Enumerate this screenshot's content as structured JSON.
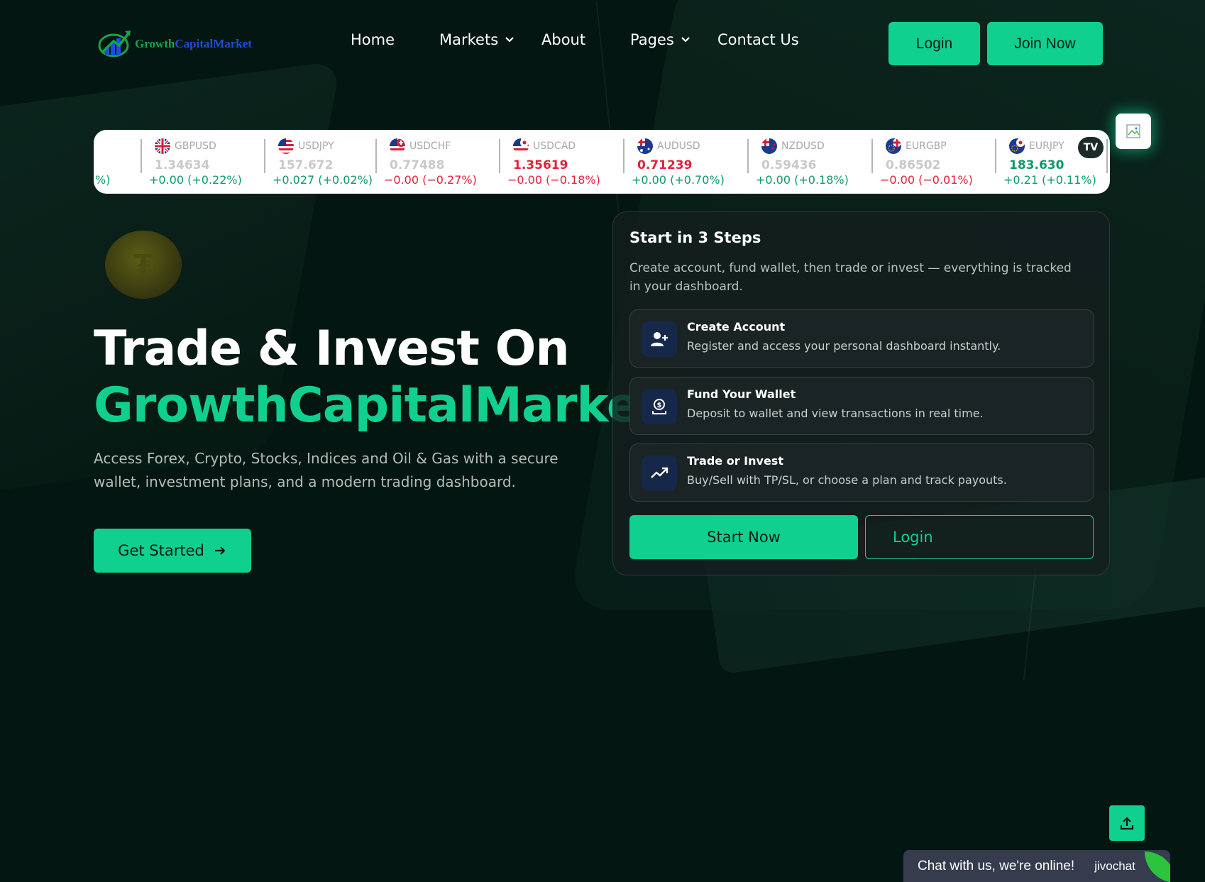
{
  "brand": {
    "part1": "Growth",
    "part2": "CapitalMarket"
  },
  "nav": {
    "home": "Home",
    "markets": "Markets",
    "about": "About",
    "pages": "Pages",
    "contact": "Contact Us"
  },
  "header_buttons": {
    "login": "Login",
    "join": "Join Now"
  },
  "ticker": {
    "partial": "%)",
    "items": [
      {
        "symbol": "GBPUSD",
        "price": "1.34634",
        "change": "+0.00 (+0.22%)"
      },
      {
        "symbol": "USDJPY",
        "price": "157.672",
        "change": "+0.027 (+0.02%)"
      },
      {
        "symbol": "USDCHF",
        "price": "0.77488",
        "change": "−0.00 (−0.27%)"
      },
      {
        "symbol": "USDCAD",
        "price": "1.35619",
        "change": "−0.00 (−0.18%)"
      },
      {
        "symbol": "AUDUSD",
        "price": "0.71239",
        "change": "+0.00 (+0.70%)"
      },
      {
        "symbol": "NZDUSD",
        "price": "0.59436",
        "change": "+0.00 (+0.18%)"
      },
      {
        "symbol": "EURGBP",
        "price": "0.86502",
        "change": "−0.00 (−0.01%)"
      },
      {
        "symbol": "EURJPY",
        "price": "183.630",
        "change": "+0.21 (+0.11%)"
      }
    ],
    "badge": "TV"
  },
  "hero": {
    "title_line1": "Trade & Invest On",
    "title_line2": "GrowthCapitalMarket",
    "subtitle": "Access Forex, Crypto, Stocks, Indices and Oil & Gas with a secure wallet, investment plans, and a modern trading dashboard.",
    "cta": "Get Started"
  },
  "steps_card": {
    "title": "Start in 3 Steps",
    "description": "Create account, fund wallet, then trade or invest — everything is tracked in your dashboard.",
    "steps": [
      {
        "title": "Create Account",
        "desc": "Register and access your personal dashboard instantly.",
        "icon": "user-plus-icon"
      },
      {
        "title": "Fund Your Wallet",
        "desc": "Deposit to wallet and view transactions in real time.",
        "icon": "wallet-deposit-icon"
      },
      {
        "title": "Trade or Invest",
        "desc": "Buy/Sell with TP/SL, or choose a plan and track payouts.",
        "icon": "trending-up-icon"
      }
    ],
    "start_button": "Start Now",
    "login_button": "Login"
  },
  "chat": {
    "text": "Chat with us, we're online!",
    "brand": "jivochat"
  },
  "colors": {
    "accent": "#10d08f",
    "background": "#041611",
    "up": "#0c9a6a",
    "down": "#e5213a"
  }
}
